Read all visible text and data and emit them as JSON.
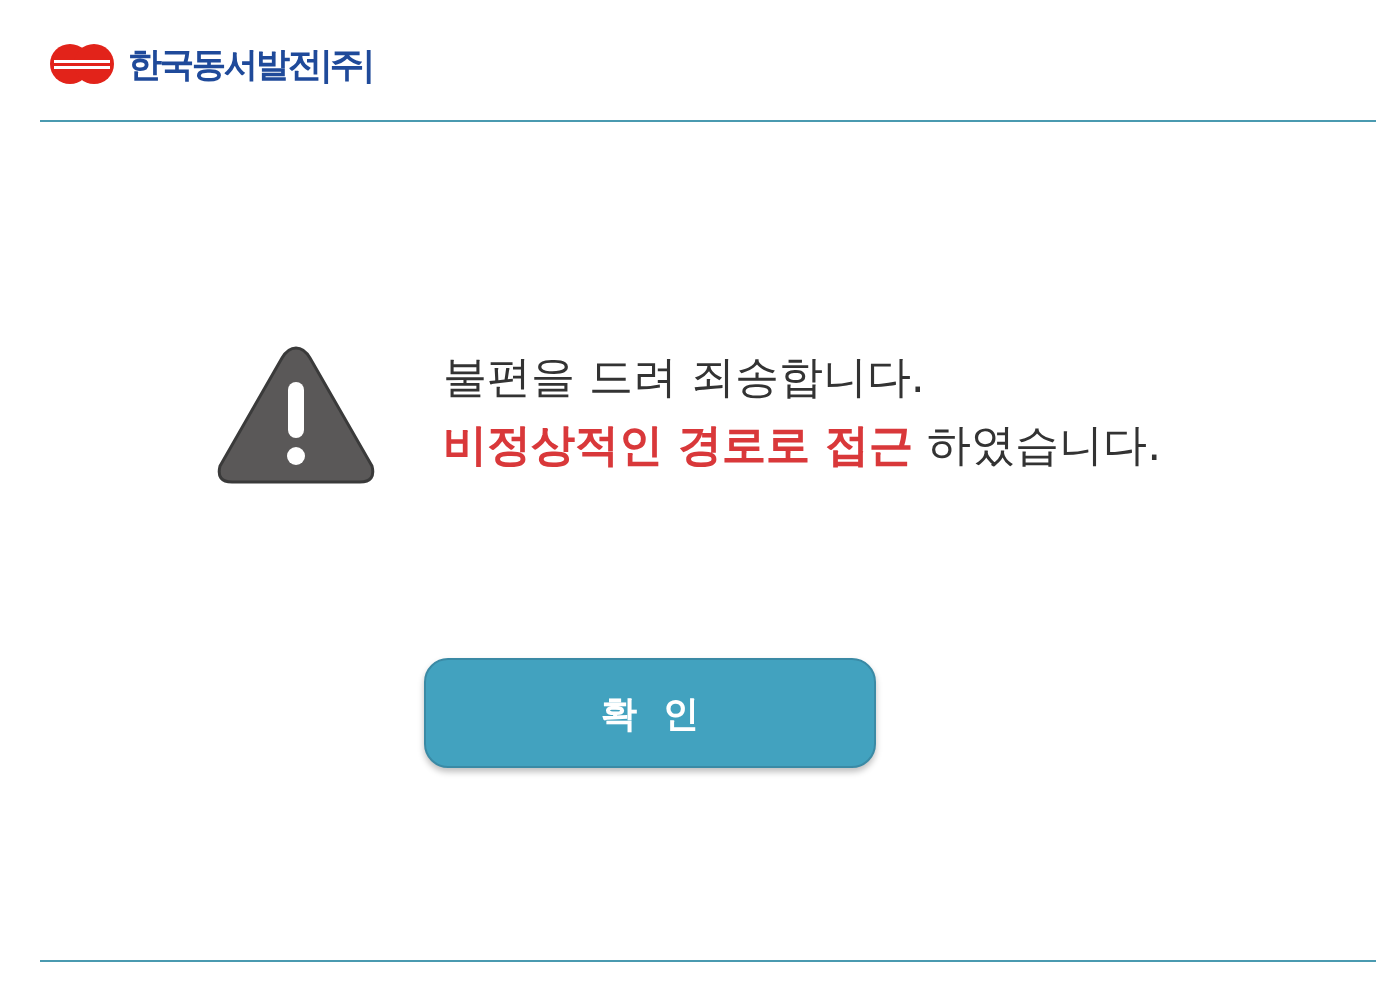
{
  "header": {
    "company": "한국동서발전|주|"
  },
  "message": {
    "lines": [
      {
        "segments": [
          {
            "text": "불편을 드려 죄송합니다.",
            "emphasis": false
          }
        ]
      },
      {
        "segments": [
          {
            "text": "비정상적인 경로로 접근",
            "emphasis": true
          },
          {
            "text": " 하였습니다.",
            "emphasis": false
          }
        ]
      }
    ]
  },
  "button": {
    "label": "확  인"
  }
}
